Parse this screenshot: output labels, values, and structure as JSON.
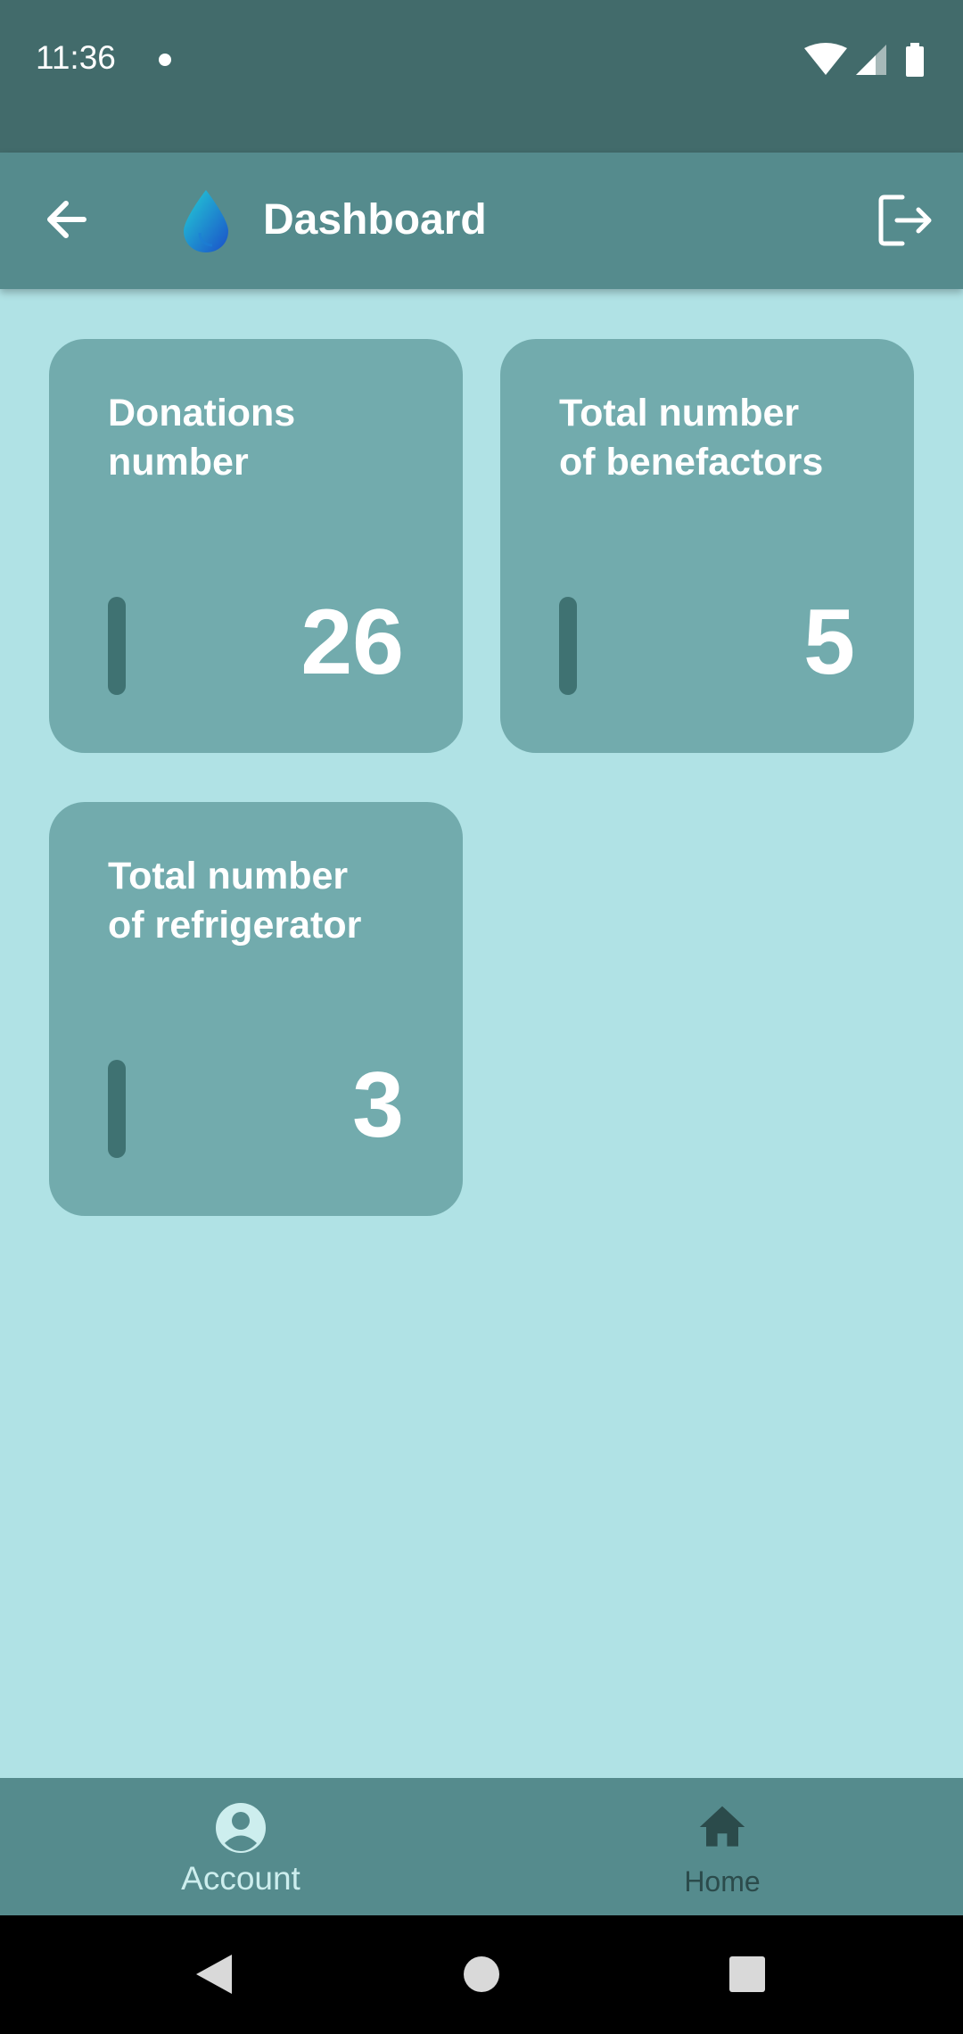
{
  "status_bar": {
    "time": "11:36"
  },
  "app_bar": {
    "title": "Dashboard"
  },
  "cards": [
    {
      "title_line1": "Donations",
      "title_line2": "number",
      "value": "26"
    },
    {
      "title_line1": "Total number",
      "title_line2": "of benefactors",
      "value": "5"
    },
    {
      "title_line1": "Total number",
      "title_line2": "of refrigerator",
      "value": "3"
    }
  ],
  "bottom_nav": {
    "items": [
      {
        "label": "Account",
        "icon": "account-circle-icon",
        "active": true
      },
      {
        "label": "Home",
        "icon": "home-icon",
        "active": false
      }
    ]
  },
  "colors": {
    "background": "#b0e2e5",
    "status_bar": "#426b6b",
    "app_bar": "#558b8d",
    "card": "#72abad",
    "card_bar": "#3f7272",
    "nav_active": "#cdeeee",
    "nav_inactive": "#2b4b4b"
  }
}
